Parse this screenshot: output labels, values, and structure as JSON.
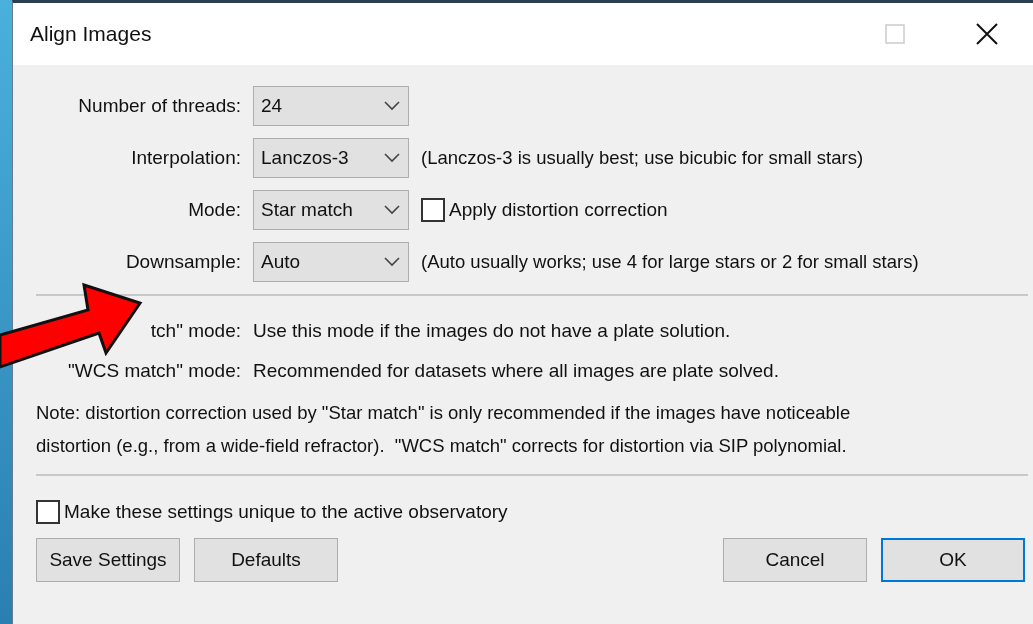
{
  "window": {
    "title": "Align Images"
  },
  "fields": [
    {
      "label": "Number of threads:",
      "value": "24"
    },
    {
      "label": "Interpolation:",
      "value": "Lanczos-3",
      "hint": "(Lanczos-3 is usually best; use bicubic for small stars)"
    },
    {
      "label": "Mode:",
      "value": "Star match",
      "checkbox": {
        "label": "Apply distortion correction",
        "checked": false
      }
    },
    {
      "label": "Downsample:",
      "value": "Auto",
      "hint": "(Auto usually works; use 4 for large stars or 2 for small stars)"
    }
  ],
  "mode_notes": [
    {
      "label": "tch\" mode:",
      "text": "Use this mode if the images do not have a plate solution."
    },
    {
      "label": "\"WCS match\" mode:",
      "text": "Recommended for datasets where all images are plate solved."
    }
  ],
  "note": {
    "lines": [
      "Note: distortion correction used by \"Star match\" is only recommended if the images have noticeable",
      "distortion (e.g., from a wide-field refractor).  \"WCS match\" corrects for distortion via SIP polynomial."
    ]
  },
  "unique_checkbox": {
    "label": "Make these settings unique to the active observatory",
    "checked": false
  },
  "left_buttons": [
    {
      "label": "Save Settings",
      "default": false
    },
    {
      "label": "Defaults",
      "default": false
    }
  ],
  "right_buttons": [
    {
      "label": "Cancel",
      "default": false
    },
    {
      "label": "OK",
      "default": true
    }
  ]
}
